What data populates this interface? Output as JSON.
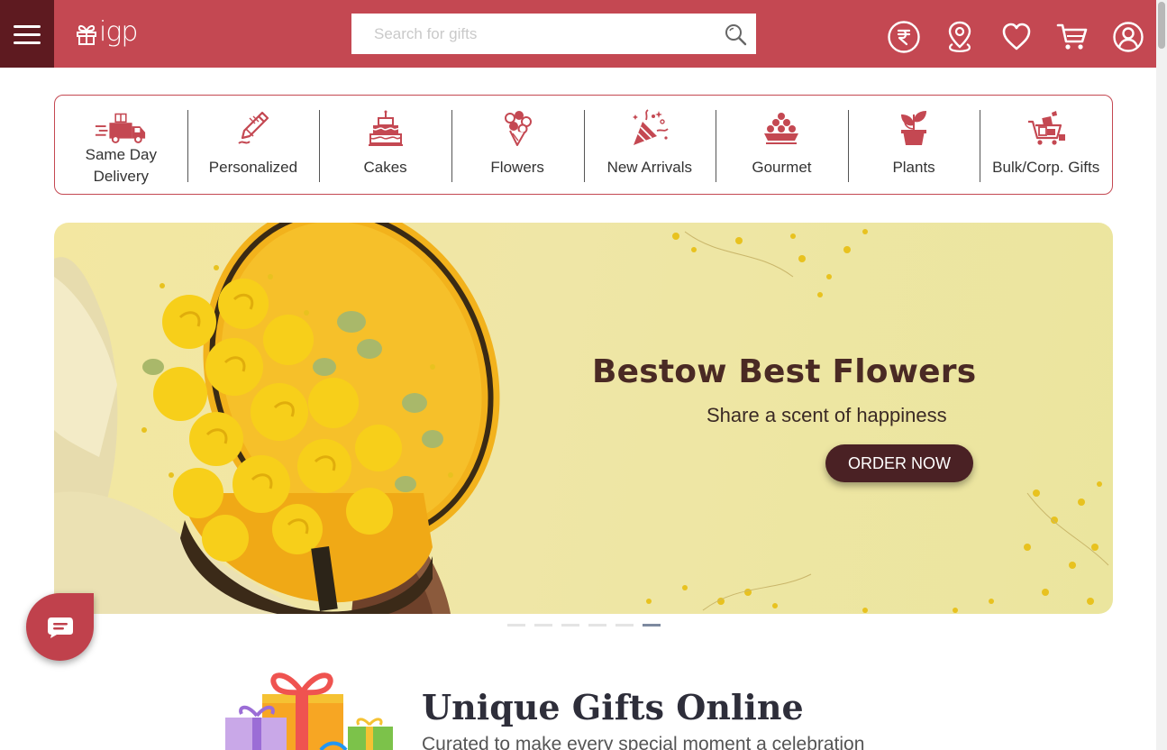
{
  "header": {
    "logo_text": "igp",
    "search_placeholder": "Search for gifts",
    "icons": [
      "menu-icon",
      "rupee-icon",
      "location-icon",
      "heart-icon",
      "cart-icon",
      "user-icon"
    ]
  },
  "categories": [
    {
      "label": "Same Day Delivery",
      "icon": "delivery-truck-icon"
    },
    {
      "label": "Personalized",
      "icon": "pencil-icon"
    },
    {
      "label": "Cakes",
      "icon": "cake-icon"
    },
    {
      "label": "Flowers",
      "icon": "bouquet-icon"
    },
    {
      "label": "New Arrivals",
      "icon": "party-popper-icon"
    },
    {
      "label": "Gourmet",
      "icon": "sweets-icon"
    },
    {
      "label": "Plants",
      "icon": "plant-icon"
    },
    {
      "label": "Bulk/Corp. Gifts",
      "icon": "gift-cart-icon"
    }
  ],
  "banner": {
    "title": "Bestow Best Flowers",
    "subtitle": "Share a scent of happiness",
    "cta": "ORDER NOW",
    "slide_count": 6,
    "active_slide": 6
  },
  "intro": {
    "title": "Unique Gifts Online",
    "subtitle": "Curated to make every special moment a celebration"
  },
  "colors": {
    "brand": "#c44852",
    "brand_dark": "#5e1a20",
    "banner_bg": "#efe6a6",
    "cta_bg": "#4a2124"
  }
}
